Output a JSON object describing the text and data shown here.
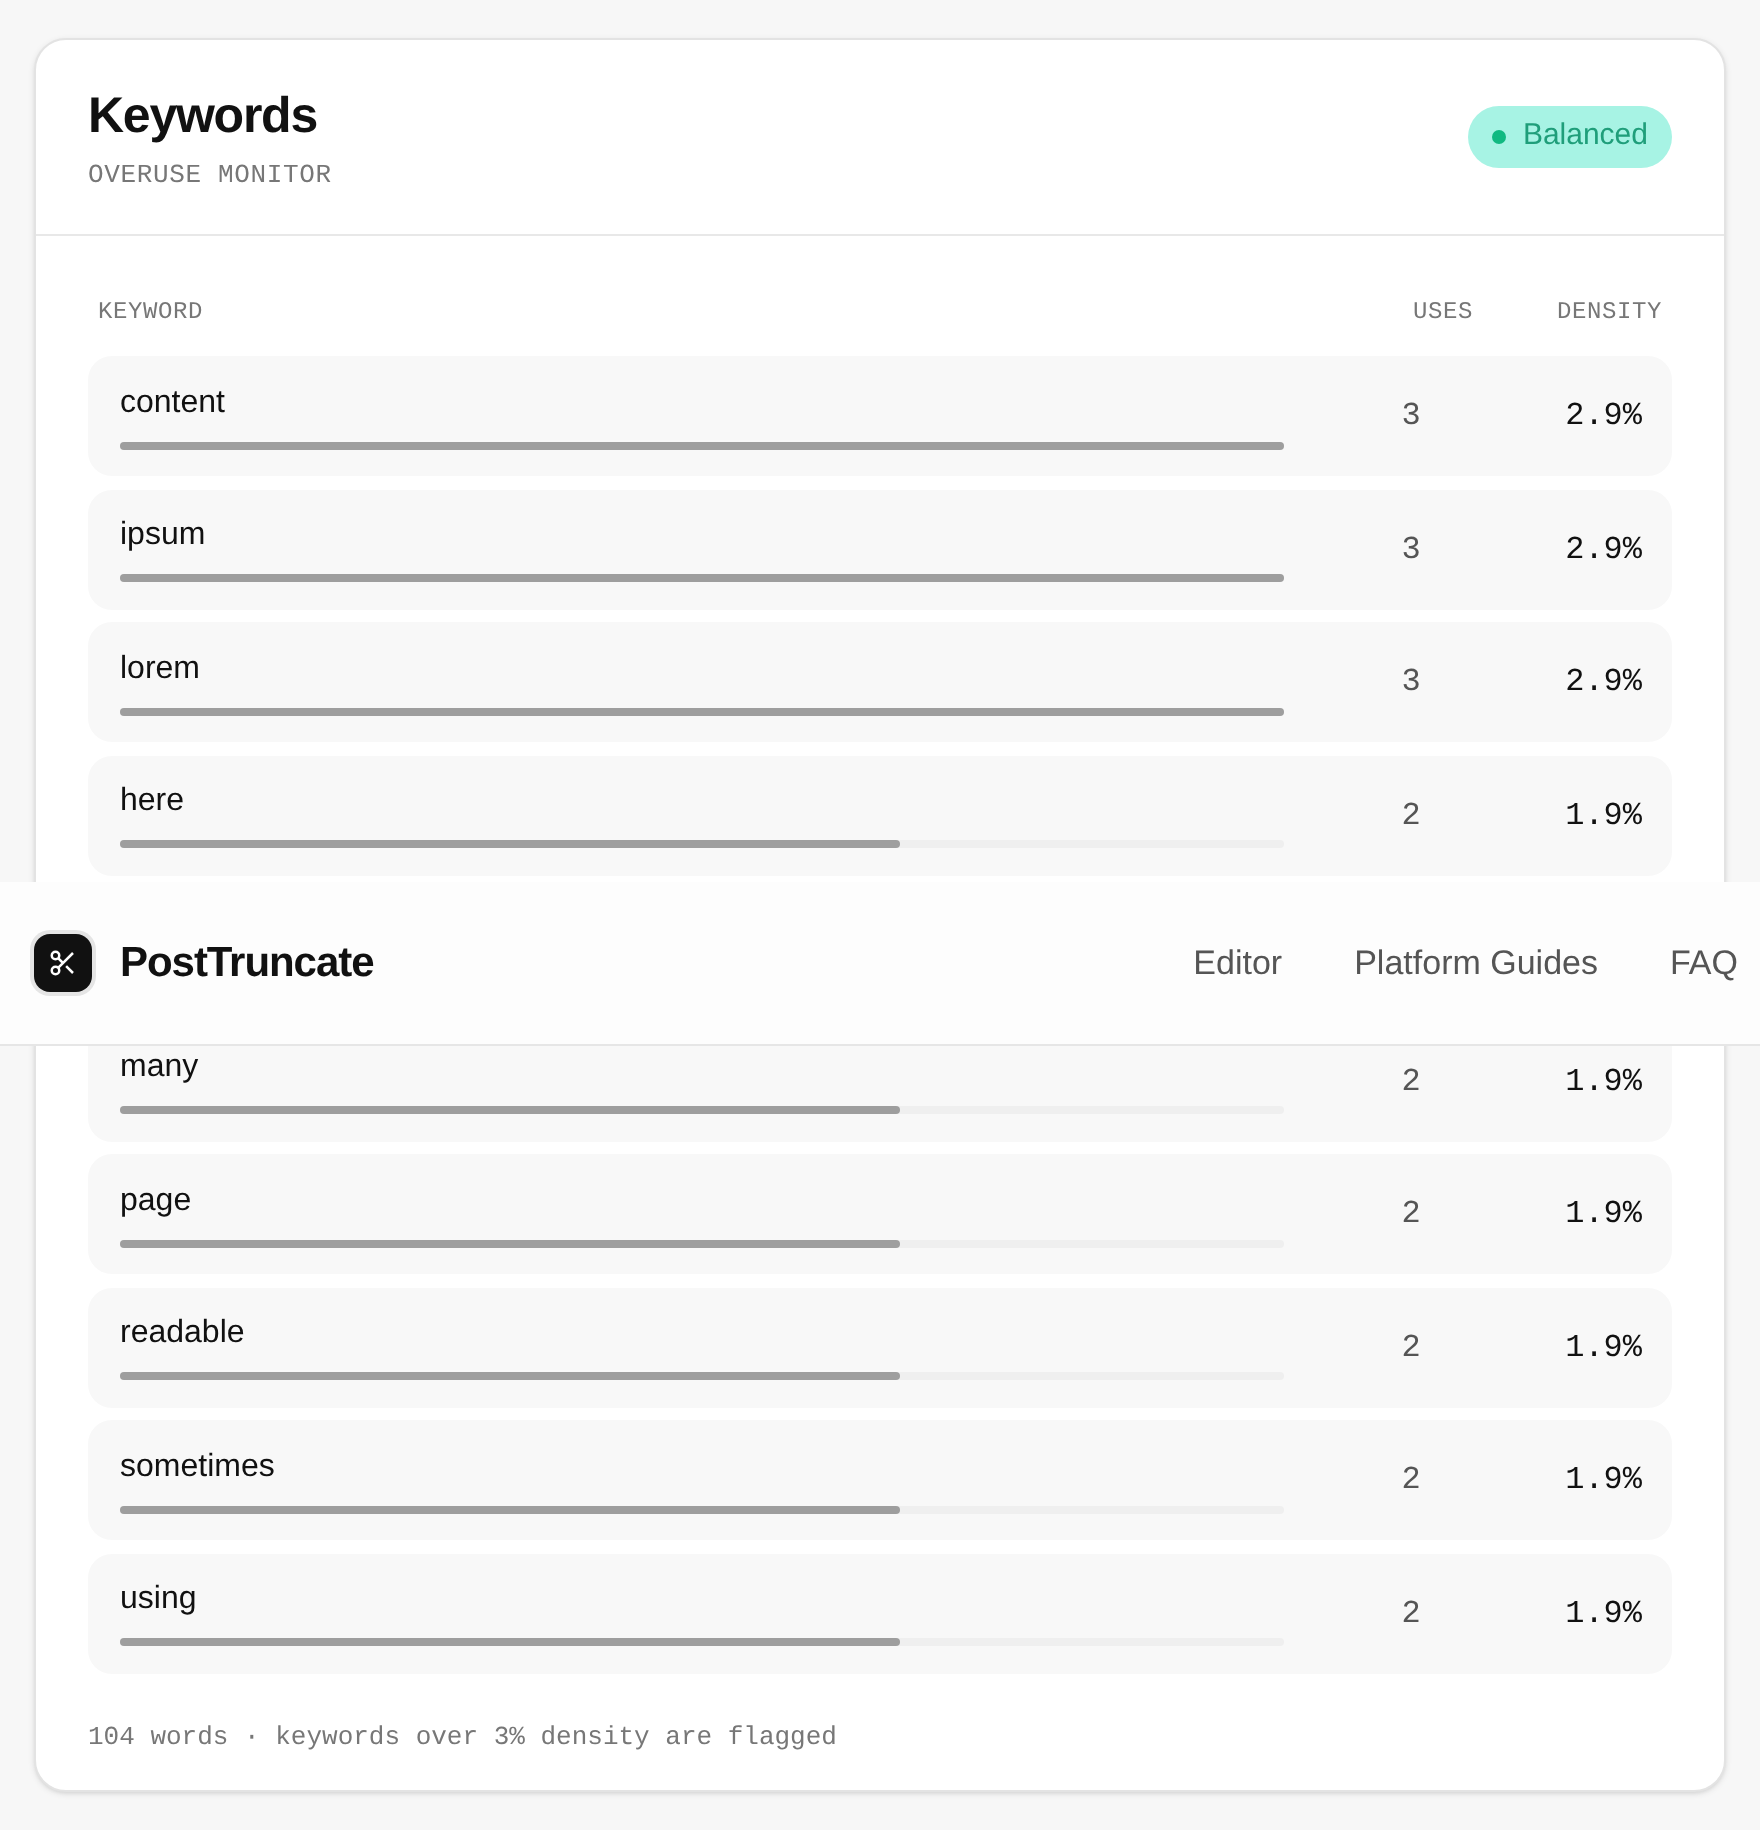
{
  "card": {
    "title": "Keywords",
    "subtitle": "OVERUSE MONITOR",
    "status": {
      "label": "Balanced",
      "color": "#10b981"
    }
  },
  "table": {
    "columns": [
      "KEYWORD",
      "USES",
      "DENSITY"
    ],
    "rows": [
      {
        "keyword": "content",
        "uses": "3",
        "density": "2.9%",
        "level": 1
      },
      {
        "keyword": "ipsum",
        "uses": "3",
        "density": "2.9%",
        "level": 1
      },
      {
        "keyword": "lorem",
        "uses": "3",
        "density": "2.9%",
        "level": 1
      },
      {
        "keyword": "here",
        "uses": "2",
        "density": "1.9%",
        "level": 0.67
      },
      {
        "keyword": "many",
        "uses": "2",
        "density": "1.9%",
        "level": 0.67
      },
      {
        "keyword": "page",
        "uses": "2",
        "density": "1.9%",
        "level": 0.67
      },
      {
        "keyword": "readable",
        "uses": "2",
        "density": "1.9%",
        "level": 0.67
      },
      {
        "keyword": "sometimes",
        "uses": "2",
        "density": "1.9%",
        "level": 0.67
      },
      {
        "keyword": "using",
        "uses": "2",
        "density": "1.9%",
        "level": 0.67
      }
    ]
  },
  "footer": "104 words · keywords over 3% density are flagged",
  "navbar": {
    "brand": "PostTruncate",
    "links": [
      "Editor",
      "Platform Guides",
      "FAQ"
    ]
  }
}
